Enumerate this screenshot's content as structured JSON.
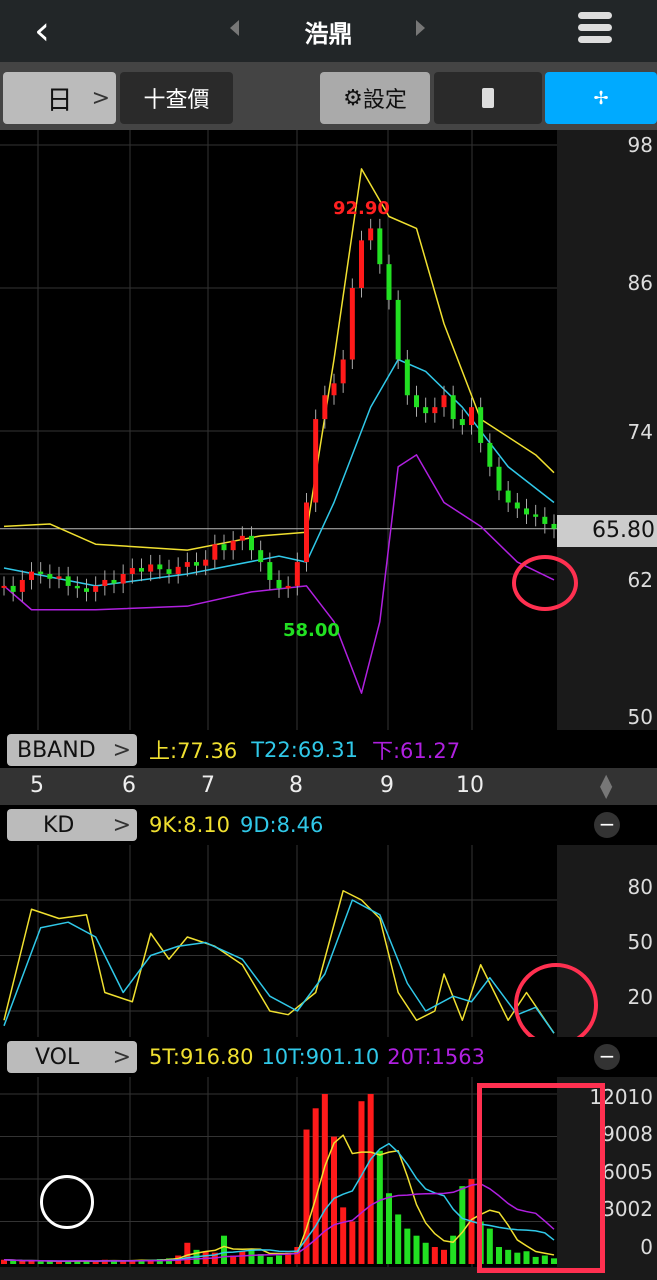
{
  "header": {
    "title": "浩鼎",
    "back": "‹"
  },
  "toolbar": {
    "period": "日",
    "period_chev": ">",
    "quote": "十查價",
    "settings": "設定",
    "settings_icon": "⚙"
  },
  "price_axis": [
    "98",
    "86",
    "74",
    "62",
    "50"
  ],
  "current_price": "65.80",
  "annotations": {
    "high": "92.90",
    "low": "58.00"
  },
  "bband": {
    "label": "BBAND",
    "upper": "上:77.36",
    "mid": "T22:69.31",
    "lower": "下:61.27"
  },
  "dates": [
    "5",
    "6",
    "7",
    "8",
    "9",
    "10"
  ],
  "kd": {
    "label": "KD",
    "k": "9K:8.10",
    "d": "9D:8.46",
    "axis": [
      "80",
      "50",
      "20"
    ]
  },
  "vol": {
    "label": "VOL",
    "ma5": "5T:916.80",
    "ma10": "10T:901.10",
    "ma20": "20T:1563",
    "axis": [
      "12010",
      "9008",
      "6005",
      "3002",
      "0"
    ]
  },
  "colors": {
    "up": "#ff1a1a",
    "down": "#22e022",
    "upper": "#f0e030",
    "mid": "#30c8e8",
    "lower": "#b020e0",
    "accent": "#00aaff",
    "highlight": "#ff3050"
  },
  "chart_data": {
    "type": "candlestick",
    "price_range": [
      50,
      98
    ],
    "closes": [
      61,
      60.5,
      61.5,
      62.2,
      62,
      61.6,
      61.8,
      61,
      60.8,
      60.5,
      61,
      61.5,
      61.2,
      62,
      62.5,
      62.2,
      62.8,
      62.4,
      62,
      62.6,
      63,
      62.7,
      63.2,
      64.5,
      64,
      64.8,
      65.2,
      64,
      63,
      61.5,
      60.8,
      61,
      63,
      68,
      75,
      77,
      78,
      80,
      86,
      90,
      91,
      88,
      85,
      80,
      77,
      76,
      75.5,
      76,
      77,
      75,
      74.5,
      76,
      73,
      71,
      69,
      68,
      67.5,
      67,
      66.8,
      66.2,
      65.8
    ],
    "bb_upper": [
      [
        0,
        66
      ],
      [
        5,
        66.2
      ],
      [
        10,
        64.5
      ],
      [
        20,
        64
      ],
      [
        28,
        65.2
      ],
      [
        33,
        65.5
      ],
      [
        36,
        80
      ],
      [
        39,
        96
      ],
      [
        42,
        92
      ],
      [
        45,
        91
      ],
      [
        48,
        83
      ],
      [
        52,
        75
      ],
      [
        58,
        72
      ],
      [
        60,
        70.5
      ]
    ],
    "bb_mid": [
      [
        0,
        62.5
      ],
      [
        10,
        61
      ],
      [
        20,
        62
      ],
      [
        30,
        63.5
      ],
      [
        33,
        63
      ],
      [
        36,
        68
      ],
      [
        40,
        76
      ],
      [
        43,
        80
      ],
      [
        46,
        79
      ],
      [
        50,
        76
      ],
      [
        55,
        71
      ],
      [
        60,
        68
      ]
    ],
    "bb_lower": [
      [
        0,
        61
      ],
      [
        3,
        59
      ],
      [
        10,
        59
      ],
      [
        20,
        59.3
      ],
      [
        27,
        60.5
      ],
      [
        33,
        61
      ],
      [
        36,
        58
      ],
      [
        39,
        52
      ],
      [
        41,
        58
      ],
      [
        43,
        71
      ],
      [
        45,
        72
      ],
      [
        48,
        68
      ],
      [
        52,
        66
      ],
      [
        56,
        63
      ],
      [
        60,
        61.5
      ]
    ],
    "kd_k": [
      [
        0,
        15
      ],
      [
        3,
        75
      ],
      [
        6,
        70
      ],
      [
        9,
        72
      ],
      [
        11,
        30
      ],
      [
        14,
        25
      ],
      [
        16,
        62
      ],
      [
        18,
        48
      ],
      [
        20,
        60
      ],
      [
        23,
        55
      ],
      [
        26,
        45
      ],
      [
        29,
        20
      ],
      [
        31,
        18
      ],
      [
        34,
        30
      ],
      [
        37,
        85
      ],
      [
        39,
        80
      ],
      [
        41,
        70
      ],
      [
        43,
        30
      ],
      [
        45,
        15
      ],
      [
        47,
        20
      ],
      [
        48,
        40
      ],
      [
        50,
        15
      ],
      [
        52,
        45
      ],
      [
        55,
        15
      ],
      [
        57,
        30
      ],
      [
        60,
        8
      ]
    ],
    "kd_d": [
      [
        0,
        12
      ],
      [
        4,
        65
      ],
      [
        7,
        68
      ],
      [
        10,
        60
      ],
      [
        13,
        30
      ],
      [
        16,
        50
      ],
      [
        19,
        55
      ],
      [
        22,
        57
      ],
      [
        26,
        48
      ],
      [
        29,
        28
      ],
      [
        32,
        20
      ],
      [
        35,
        40
      ],
      [
        38,
        80
      ],
      [
        41,
        72
      ],
      [
        44,
        35
      ],
      [
        46,
        20
      ],
      [
        49,
        28
      ],
      [
        51,
        25
      ],
      [
        53,
        38
      ],
      [
        56,
        18
      ],
      [
        58,
        22
      ],
      [
        60,
        8
      ]
    ],
    "volume": [
      300,
      250,
      200,
      220,
      180,
      200,
      150,
      220,
      250,
      200,
      180,
      300,
      250,
      200,
      260,
      300,
      280,
      350,
      400,
      600,
      1500,
      1000,
      900,
      800,
      2000,
      600,
      900,
      1000,
      700,
      500,
      600,
      800,
      1200,
      9500,
      11000,
      12010,
      9000,
      4000,
      3000,
      11500,
      12010,
      8000,
      5000,
      3500,
      2500,
      2000,
      1500,
      1200,
      1000,
      2000,
      5500,
      6000,
      3000,
      2500,
      1200,
      1000,
      800,
      900,
      500,
      600,
      400
    ],
    "vol_range": [
      0,
      12010
    ]
  }
}
